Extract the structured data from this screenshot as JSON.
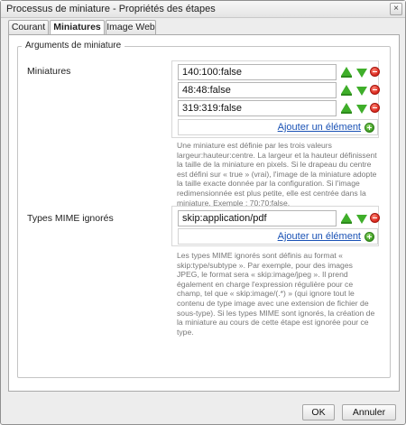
{
  "window": {
    "title": "Processus de miniature - Propriétés des étapes",
    "close_glyph": "×"
  },
  "tabs": [
    {
      "label": "Courant",
      "active": false
    },
    {
      "label": "Miniatures",
      "active": true
    },
    {
      "label": "Image Web",
      "active": false
    }
  ],
  "fieldset": {
    "legend": "Arguments de miniature"
  },
  "miniatures": {
    "label": "Miniatures",
    "values": [
      "140:100:false",
      "48:48:false",
      "319:319:false"
    ],
    "add_label": "Ajouter un élément",
    "help": "Une miniature est définie par les trois valeurs largeur:hauteur:centre. La largeur et la hauteur définissent la taille de la miniature en pixels. Si le drapeau du centre est défini sur « true » (vrai), l'image de la miniature adopte la taille exacte donnée par la configuration. Si l'image redimensionnée est plus petite, elle est centrée dans la miniature. Exemple : 70:70:false."
  },
  "mime": {
    "label": "Types MIME ignorés",
    "values": [
      "skip:application/pdf"
    ],
    "add_label": "Ajouter un élément",
    "help": "Les types MIME ignorés sont définis au format « skip:type/subtype ». Par exemple, pour des images JPEG, le format sera « skip:image/jpeg ». Il prend également en charge l'expression régulière pour ce champ, tel que « skip:image/(.*) » (qui ignore tout le contenu de type image avec une extension de fichier de sous-type). Si les types MIME sont ignorés, la création de la miniature au cours de cette étape est ignorée pour ce type."
  },
  "footer": {
    "ok_label": "OK",
    "cancel_label": "Annuler"
  },
  "icons": {
    "move_up": "arrow-up-icon",
    "move_down": "arrow-down-icon",
    "remove": "remove-icon",
    "add": "add-icon"
  },
  "colors": {
    "link": "#1a52b5",
    "green_icon": "#3fae2a",
    "red_icon": "#d8231a",
    "help_text": "#777777"
  }
}
